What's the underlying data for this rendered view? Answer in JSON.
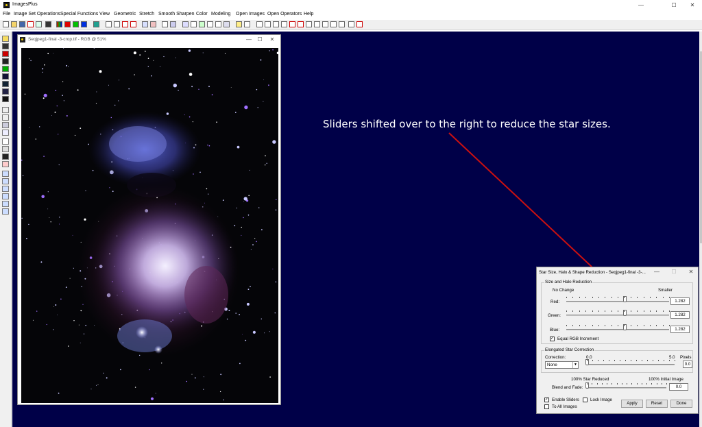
{
  "app": {
    "title": "ImagesPlus"
  },
  "window_controls": {
    "minimize": "—",
    "maximize": "☐",
    "close": "✕"
  },
  "menu": [
    "File",
    "Image Set Operations",
    "Special Functions",
    "View",
    "Geometric",
    "Stretch",
    "Smooth Sharpen",
    "Color",
    "Modeling",
    "Open Images",
    "Open Operators",
    "Help"
  ],
  "image_window": {
    "title": "Seqjpeg1-final -3-crop.tif - RGB @ 51%"
  },
  "annotation": {
    "text": "Sliders shifted over to the right to reduce the star sizes.",
    "color": "#cc1010"
  },
  "dialog": {
    "title": "Star Size, Halo & Shape Reduction - Seqjpeg1-final -3-...",
    "size_group": {
      "label": "Size and Halo Reduction",
      "left_label": "No Change",
      "right_label": "Smaller",
      "rows": [
        {
          "label": "Red:",
          "value": "1.282",
          "fraction": 0.57
        },
        {
          "label": "Green:",
          "value": "1.282",
          "fraction": 0.57
        },
        {
          "label": "Blue:",
          "value": "1.282",
          "fraction": 0.57
        }
      ],
      "equal_label": "Equal RGB Increment",
      "equal_checked": "✓"
    },
    "elong_group": {
      "label": "Elongated Star Correction",
      "correction_label": "Correction:",
      "min": "0.0",
      "max": "5.0",
      "unit": "Pixels",
      "select_value": "None",
      "value": "0.0",
      "fraction": 0.0
    },
    "blend": {
      "left_label": "100% Star Reduced",
      "right_label": "100% Initial Image",
      "label": "Blend and Fade:",
      "value": "0.0",
      "fraction": 0.0
    },
    "enable_sliders": {
      "label": "Enable Sliders",
      "checked": "✓"
    },
    "lock_image": {
      "label": "Lock Image"
    },
    "to_all": {
      "label": "To All Images"
    },
    "buttons": {
      "apply": "Apply",
      "reset": "Reset",
      "done": "Done"
    }
  }
}
